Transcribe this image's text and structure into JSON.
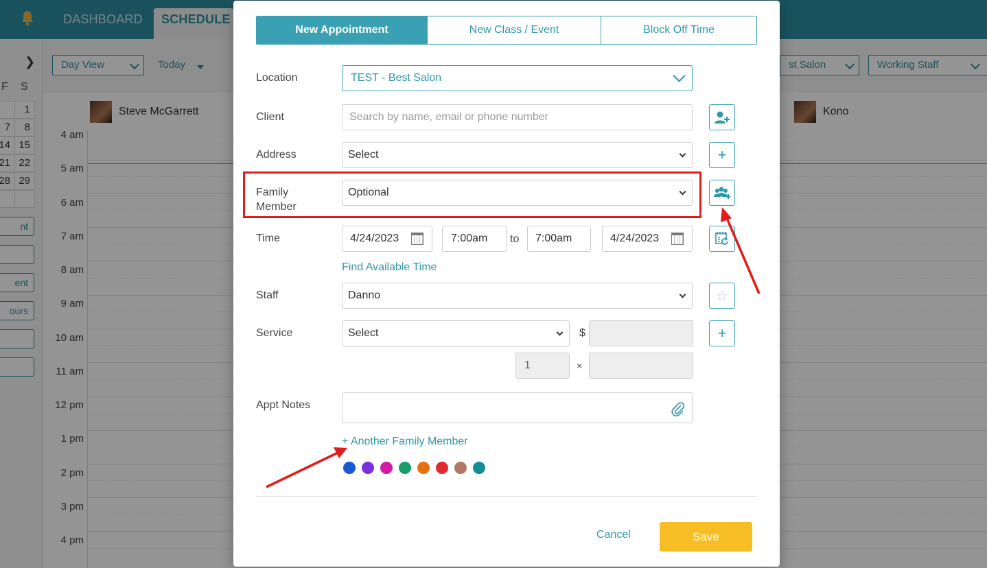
{
  "nav": {
    "tabs": [
      "DASHBOARD",
      "SCHEDULE"
    ]
  },
  "mini_calendar": {
    "headers": [
      "F",
      "S"
    ],
    "rows": [
      [
        "",
        "1"
      ],
      [
        "7",
        "8"
      ],
      [
        "14",
        "15"
      ],
      [
        "21",
        "22"
      ],
      [
        "28",
        "29"
      ]
    ]
  },
  "side_buttons": [
    "nt",
    "",
    "ent",
    "ours",
    "",
    ""
  ],
  "toolbar": {
    "view": "Day View",
    "today": "Today",
    "location_filter": "st Salon",
    "staff_filter": "Working Staff"
  },
  "staff": [
    "Steve McGarrett",
    "Kono"
  ],
  "hours": [
    "4 am",
    "5 am",
    "6 am",
    "7 am",
    "8 am",
    "9 am",
    "10 am",
    "11 am",
    "12 pm",
    "1 pm",
    "2 pm",
    "3 pm",
    "4 pm"
  ],
  "modal": {
    "tabs": [
      "New Appointment",
      "New Class / Event",
      "Block Off Time"
    ],
    "location": {
      "label": "Location",
      "value": "TEST - Best Salon"
    },
    "client": {
      "label": "Client",
      "placeholder": "Search by name, email or phone number"
    },
    "address": {
      "label": "Address",
      "value": "Select"
    },
    "family_member": {
      "label": "Family Member",
      "value": "Optional"
    },
    "time": {
      "label": "Time",
      "start_date": "4/24/2023",
      "start_time": "7:00am",
      "to": "to",
      "end_time": "7:00am",
      "end_date": "4/24/2023",
      "find_link": "Find Available Time"
    },
    "staff": {
      "label": "Staff",
      "value": "Danno"
    },
    "service": {
      "label": "Service",
      "value": "Select",
      "currency": "$",
      "quantity": "1",
      "times": "×"
    },
    "notes": {
      "label": "Appt Notes"
    },
    "another_family": "+ Another Family Member",
    "colors": [
      "#1859d3",
      "#7b2fe0",
      "#d21aa7",
      "#1a9c6a",
      "#e4700f",
      "#e02c31",
      "#b07862",
      "#178a98"
    ],
    "cancel": "Cancel",
    "save": "Save"
  }
}
